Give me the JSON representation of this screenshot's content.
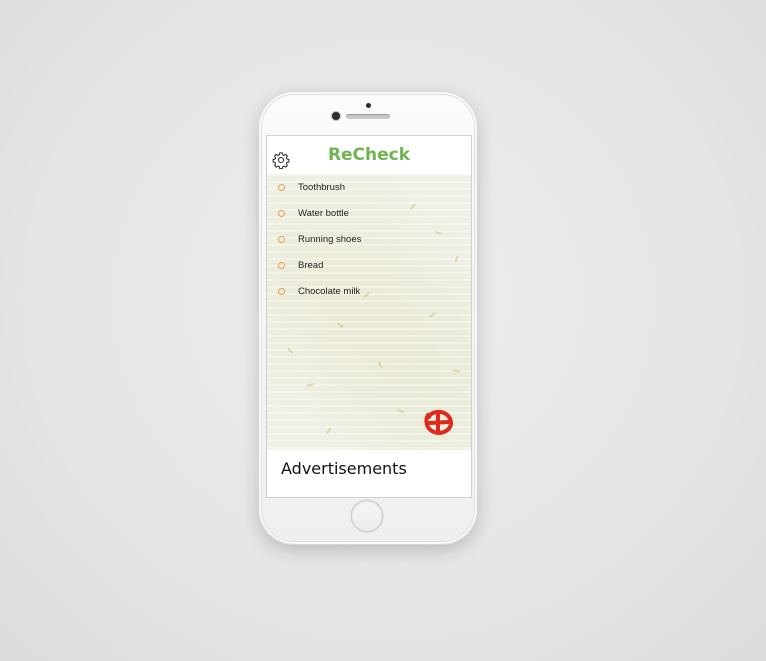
{
  "app": {
    "title": "ReCheck",
    "title_color": "#6fb44e"
  },
  "header": {
    "settings_icon": "gear-icon"
  },
  "checklist": {
    "bullet_color": "#e8a14f",
    "items": [
      {
        "label": "Toothbrush"
      },
      {
        "label": "Water bottle"
      },
      {
        "label": "Running shoes"
      },
      {
        "label": "Bread"
      },
      {
        "label": "Chocolate milk"
      }
    ]
  },
  "add_button": {
    "icon": "plus-icon",
    "color": "#e0281c"
  },
  "ads": {
    "label": "Advertisements"
  }
}
